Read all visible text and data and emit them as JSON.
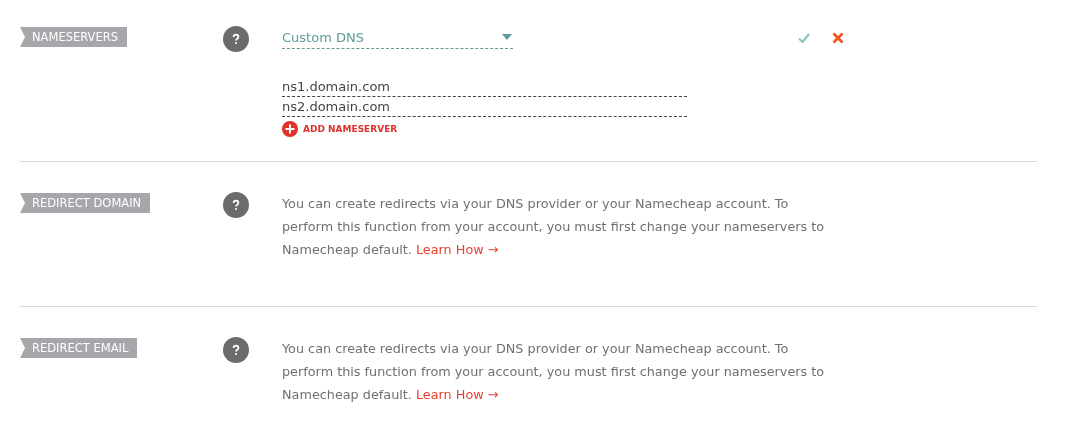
{
  "sections": [
    {
      "kind": "nameservers",
      "label": "NAMESERVERS",
      "select": {
        "value": "Custom DNS"
      },
      "nameservers": [
        "ns1.domain.com",
        "ns2.domain.com"
      ],
      "add_button": "ADD NAMESERVER"
    },
    {
      "kind": "info",
      "label": "REDIRECT DOMAIN",
      "text": "You can create redirects via your DNS provider or your Namecheap account. To perform this function from your account, you must first change your nameservers to Namecheap default.",
      "link": "Learn How →"
    },
    {
      "kind": "info",
      "label": "REDIRECT EMAIL",
      "text": "You can create redirects via your DNS provider or your Namecheap account. To perform this function from your account, you must first change your nameservers to Namecheap default.",
      "link": "Learn How →"
    }
  ]
}
